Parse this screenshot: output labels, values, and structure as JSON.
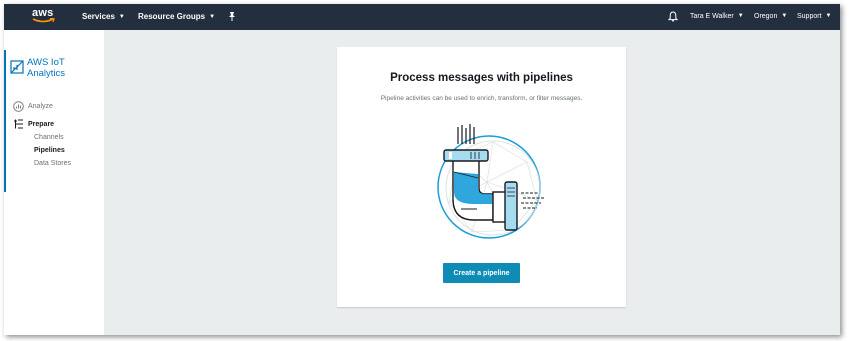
{
  "topbar": {
    "logo_text": "aws",
    "services": "Services",
    "resource_groups": "Resource Groups",
    "user": "Tara E Walker",
    "region": "Oregon",
    "support": "Support",
    "background_color": "#232f3e"
  },
  "sidebar": {
    "service_title_line1": "AWS IoT",
    "service_title_line2": "Analytics",
    "analyze": "Analyze",
    "prepare": "Prepare",
    "items": [
      {
        "label": "Channels"
      },
      {
        "label": "Pipelines"
      },
      {
        "label": "Data Stores"
      }
    ],
    "accent_color": "#0073bb"
  },
  "main": {
    "title": "Process messages with pipelines",
    "subtitle": "Pipeline activities can be used to enrich, transform, or filter messages.",
    "create_button": "Create a pipeline",
    "button_color": "#0f8cb5"
  }
}
